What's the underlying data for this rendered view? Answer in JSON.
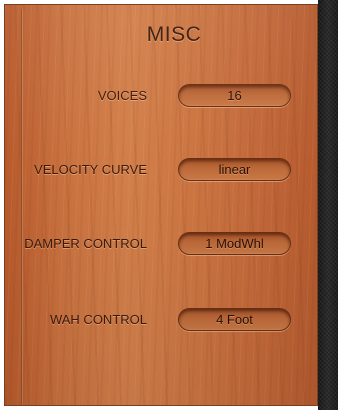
{
  "panel": {
    "title": "MISC"
  },
  "settings": [
    {
      "label": "VOICES",
      "value": "16"
    },
    {
      "label": "VELOCITY CURVE",
      "value": "linear"
    },
    {
      "label": "DAMPER CONTROL",
      "value": "1 ModWhl"
    },
    {
      "label": "WAH CONTROL",
      "value": "4 Foot"
    }
  ]
}
